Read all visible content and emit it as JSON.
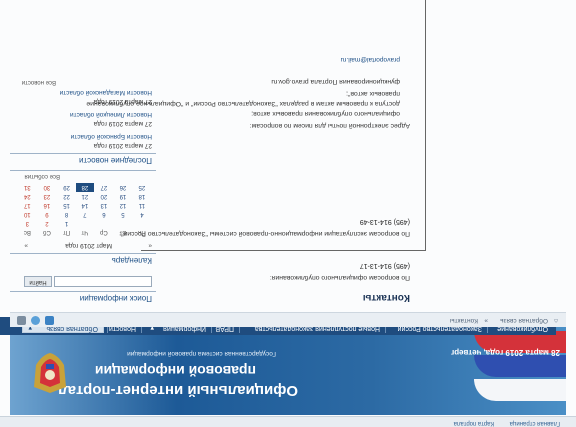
{
  "topstrip": {
    "links": [
      "Главная страница",
      "Карта портала"
    ]
  },
  "header": {
    "date": "28 марта 2019 года, четверг",
    "title_line1": "Официальный интернет-портал",
    "title_line2": "правовой информации",
    "subtitle": "Государственная система правовой информации"
  },
  "nav": {
    "items": [
      "Опубликование",
      "Законодательство России",
      "Новые поступления законодательства",
      "ПРАВ",
      "Информация",
      "Новости",
      "Обратная связь"
    ]
  },
  "crumbs": {
    "path": [
      "Обратная связь",
      "Контакты"
    ]
  },
  "sidebar": {
    "search_heading": "Поиск информации",
    "search_button": "Найти",
    "calendar_heading": "Календарь",
    "calendar_month": "Март 2019 года",
    "weekdays": [
      "Пн",
      "Вт",
      "Ср",
      "Чт",
      "Пт",
      "Сб",
      "Вс"
    ],
    "weeks": [
      [
        "",
        "",
        "",
        "",
        "1",
        "2",
        "3"
      ],
      [
        "4",
        "5",
        "6",
        "7",
        "8",
        "9",
        "10"
      ],
      [
        "11",
        "12",
        "13",
        "14",
        "15",
        "16",
        "17"
      ],
      [
        "18",
        "19",
        "20",
        "21",
        "22",
        "23",
        "24"
      ],
      [
        "25",
        "26",
        "27",
        "28",
        "29",
        "30",
        "31"
      ]
    ],
    "selected_day": "28",
    "all_events": "Все события",
    "news_heading": "Последние новости",
    "news": [
      {
        "date": "27 марта 2019 года",
        "title": "Новости Брянской области"
      },
      {
        "date": "27 марта 2019 года",
        "title": "Новости Липецкой области"
      },
      {
        "date": "27 марта 2019 года",
        "title": "Новости Магаданской области"
      }
    ],
    "all_news": "Все новости"
  },
  "main": {
    "heading": "Контакты",
    "sections": [
      {
        "label": "По вопросам официального опубликования:",
        "phone": "(495) 914-13-17"
      },
      {
        "label": "По вопросам эксплуатации информационно-правовой системы \"Законодательство России\":",
        "phone": "(495) 914-13-49"
      }
    ],
    "email_label": "Адрес электронной почты для писем по вопросам:",
    "email_topics": [
      "официального опубликования правовых актов;",
      "доступа к правовым актам в разделах \"Законодательство России\" и \"Официальное опубликование",
      "правовых актов\";",
      "функционирования Портала pravo.gov.ru"
    ],
    "email": "pravoportal@mail.ru"
  },
  "colors": {
    "nav_bg": "#1f4c7f",
    "header_accent": "#2c6aa4",
    "link": "#1d4f86",
    "weekend": "#c0392b"
  }
}
